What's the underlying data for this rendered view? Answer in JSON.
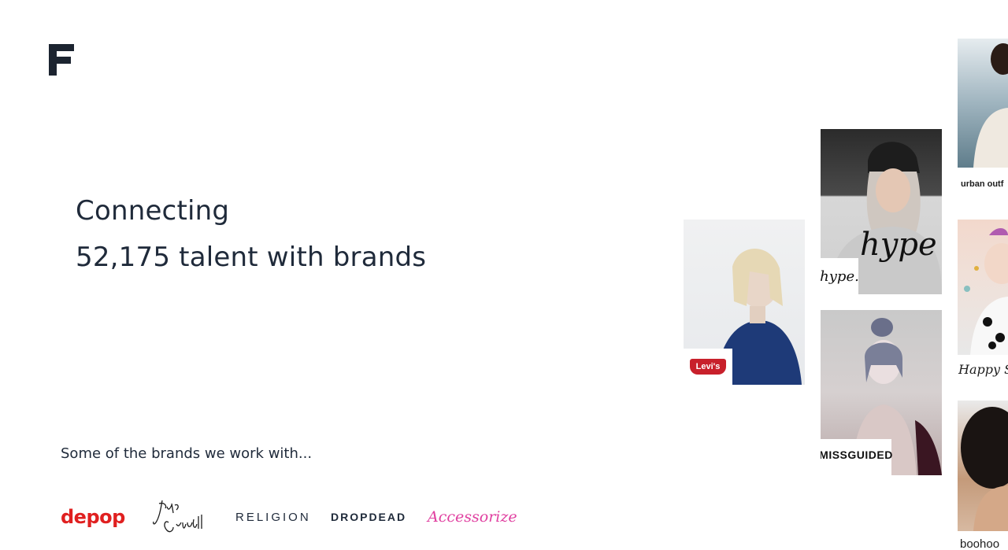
{
  "logo": {
    "letter": "F",
    "color": "#1c2430"
  },
  "hero": {
    "line1": "Connecting",
    "line2": "52,175 talent with brands"
  },
  "brands": {
    "heading": "Some of the brands we work with...",
    "logos": [
      {
        "name": "depop",
        "text": "depop",
        "color": "#e02020"
      },
      {
        "name": "jeffrey-campbell",
        "text": "Jeffrey Campbell"
      },
      {
        "name": "religion",
        "text": "RELIGION"
      },
      {
        "name": "dropdead",
        "text": "DROPDEAD"
      },
      {
        "name": "accessorize",
        "text": "Accessorize",
        "color": "#e040a0"
      }
    ]
  },
  "gallery": {
    "cards": [
      {
        "brand": "levis",
        "label": "Levi's"
      },
      {
        "brand": "hype",
        "label": "hype."
      },
      {
        "brand": "missguided",
        "label": "MISSGUIDED"
      },
      {
        "brand": "urban-outfitters",
        "label": "urban outf"
      },
      {
        "brand": "happy-socks",
        "label": "Happy Socks"
      },
      {
        "brand": "boohoo",
        "label": "boohoo"
      }
    ]
  }
}
